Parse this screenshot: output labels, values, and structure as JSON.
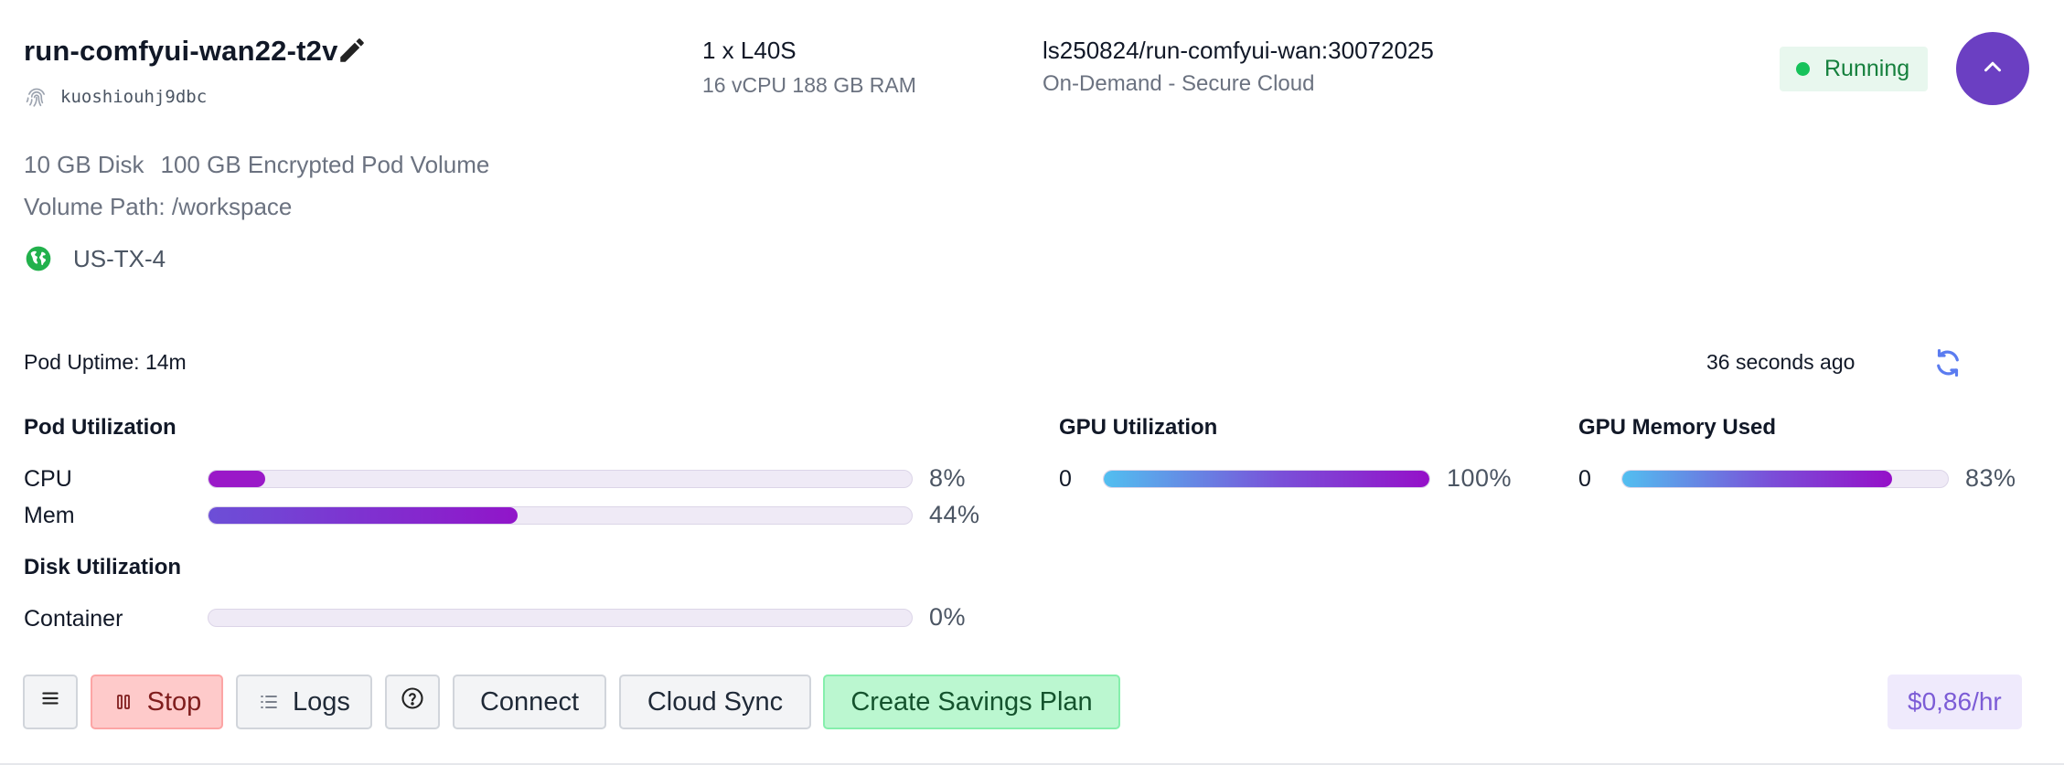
{
  "pod": {
    "name": "run-comfyui-wan22-t2v",
    "id": "kuoshiouhj9dbc",
    "gpu": "1 x L40S",
    "specs": "16 vCPU 188 GB RAM",
    "image": "ls250824/run-comfyui-wan:30072025",
    "cloud": "On-Demand - Secure Cloud",
    "status": "Running",
    "disk": "10 GB Disk",
    "volume": "100 GB Encrypted Pod Volume",
    "volume_path": "Volume Path: /workspace",
    "region": "US-TX-4"
  },
  "uptime": "Pod Uptime: 14m",
  "last_refresh": "36 seconds ago",
  "pod_utilization": {
    "title": "Pod Utilization",
    "cpu": {
      "label": "CPU",
      "value": 8,
      "display": "8%"
    },
    "mem": {
      "label": "Mem",
      "value": 44,
      "display": "44%"
    }
  },
  "disk_utilization": {
    "title": "Disk Utilization",
    "container": {
      "label": "Container",
      "value": 0,
      "display": "0%"
    }
  },
  "gpu_utilization": {
    "title": "GPU Utilization",
    "index": "0",
    "value": 100,
    "display": "100%"
  },
  "gpu_memory": {
    "title": "GPU Memory Used",
    "index": "0",
    "value": 83,
    "display": "83%"
  },
  "toolbar": {
    "stop_label": "Stop",
    "logs_label": "Logs",
    "connect_label": "Connect",
    "cloud_sync_label": "Cloud Sync",
    "savings_label": "Create Savings Plan"
  },
  "price": "$0,86/hr",
  "icons": {
    "edit": "pencil-icon",
    "fingerprint": "fingerprint-icon",
    "globe": "globe-icon",
    "collapse": "chevron-up-icon",
    "refresh": "refresh-icon",
    "menu": "menu-icon",
    "stop": "pause-icon",
    "logs": "list-icon",
    "help": "help-icon"
  },
  "colors": {
    "accent": "#6b3fc2",
    "status_green": "#16c25a",
    "stop_bg": "#fecaca",
    "savings_bg": "#bbf7d0",
    "price_text": "#7c5cd6"
  }
}
